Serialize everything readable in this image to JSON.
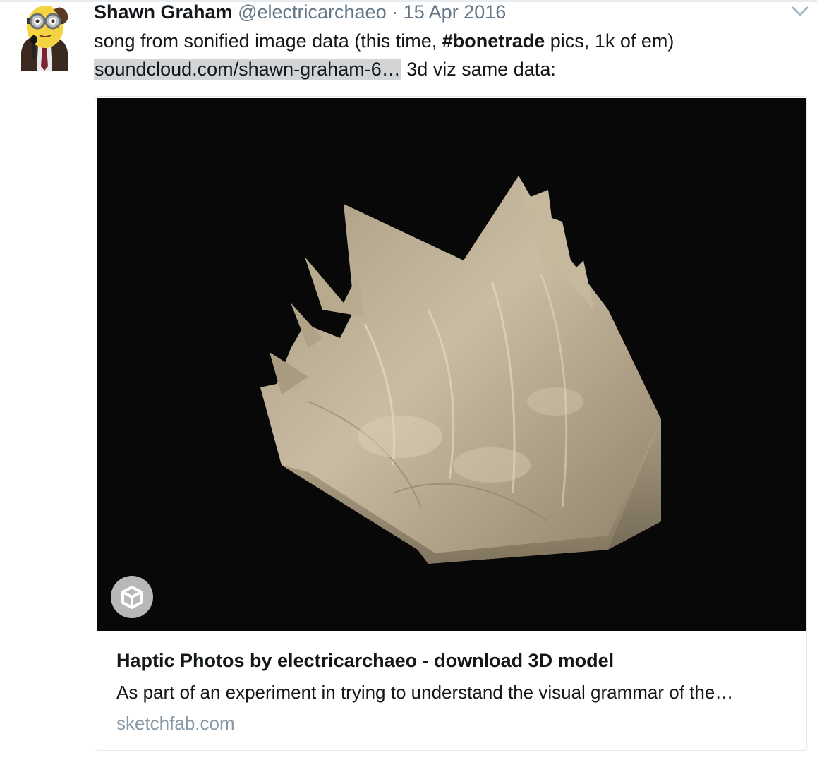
{
  "tweet": {
    "author_name": "Shawn Graham",
    "handle": "@electricarchaeo",
    "separator": "·",
    "date": "15 Apr 2016",
    "text_part1": "song from sonified image data (this time, ",
    "hashtag": "#bonetrade",
    "text_part2": " pics, 1k of em)",
    "link": "soundcloud.com/shawn-graham-6…",
    "text_part3": " 3d viz same data:"
  },
  "card": {
    "title": "Haptic Photos by electricarchaeo - download 3D model",
    "description": "As part of an experiment in trying to understand the visual grammar of the…",
    "domain": "sketchfab.com",
    "badge_icon": "sketchfab-cube-icon"
  },
  "colors": {
    "text": "#14171a",
    "secondary": "#657786",
    "domain": "#8899a6",
    "link_highlight": "#d2d4d6",
    "media_bg": "#080808",
    "surface": "#c2b49a"
  }
}
